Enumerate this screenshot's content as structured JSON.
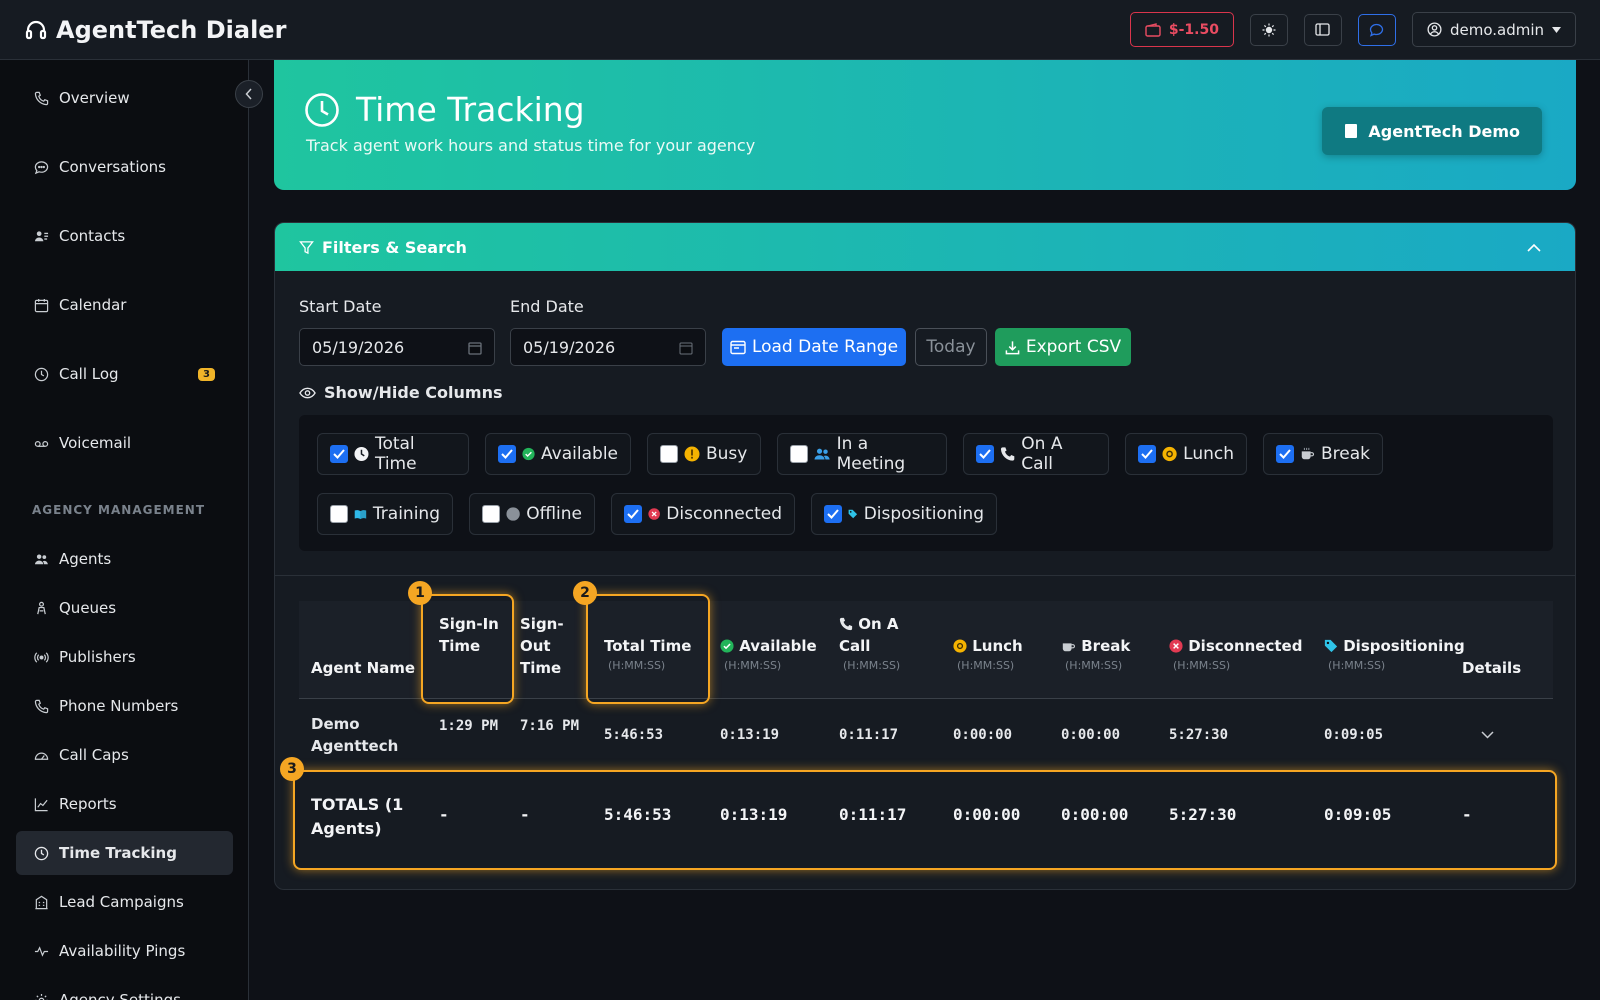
{
  "app": {
    "title": "AgentTech Dialer"
  },
  "topbar": {
    "balance": "$-1.50",
    "user": "demo.admin"
  },
  "sidebar": {
    "items": [
      {
        "label": "Overview",
        "icon": "phone-icon"
      },
      {
        "label": "Conversations",
        "icon": "chat-icon"
      },
      {
        "label": "Contacts",
        "icon": "contacts-icon"
      },
      {
        "label": "Calendar",
        "icon": "calendar-icon"
      },
      {
        "label": "Call Log",
        "icon": "clock-icon",
        "badge": "3"
      },
      {
        "label": "Voicemail",
        "icon": "voicemail-icon"
      }
    ],
    "section": "AGENCY MANAGEMENT",
    "agency_items": [
      {
        "label": "Agents",
        "icon": "users-icon"
      },
      {
        "label": "Queues",
        "icon": "queue-icon"
      },
      {
        "label": "Publishers",
        "icon": "broadcast-icon"
      },
      {
        "label": "Phone Numbers",
        "icon": "phone-icon"
      },
      {
        "label": "Call Caps",
        "icon": "gauge-icon"
      },
      {
        "label": "Reports",
        "icon": "chart-icon"
      },
      {
        "label": "Time Tracking",
        "icon": "clock-icon",
        "active": true
      },
      {
        "label": "Lead Campaigns",
        "icon": "building-icon"
      },
      {
        "label": "Availability Pings",
        "icon": "pulse-icon"
      },
      {
        "label": "Agency Settings",
        "icon": "gear-icon"
      }
    ]
  },
  "header": {
    "title": "Time Tracking",
    "subtitle": "Track agent work hours and status time for your agency",
    "agency_button": "AgentTech Demo"
  },
  "filters": {
    "title": "Filters & Search",
    "start_label": "Start Date",
    "start_value": "05/19/2026",
    "end_label": "End Date",
    "end_value": "05/19/2026",
    "load_button": "Load Date Range",
    "today_button": "Today",
    "export_button": "Export CSV",
    "columns_title": "Show/Hide Columns",
    "columns": [
      {
        "label": "Total Time",
        "checked": true,
        "icon": "clock-icon"
      },
      {
        "label": "Available",
        "checked": true,
        "icon": "check-circle-icon"
      },
      {
        "label": "Busy",
        "checked": false,
        "icon": "warning-circle-icon"
      },
      {
        "label": "In a Meeting",
        "checked": false,
        "icon": "people-icon"
      },
      {
        "label": "On A Call",
        "checked": true,
        "icon": "phone-icon"
      },
      {
        "label": "Lunch",
        "checked": true,
        "icon": "lunch-icon"
      },
      {
        "label": "Break",
        "checked": true,
        "icon": "coffee-icon"
      },
      {
        "label": "Training",
        "checked": false,
        "icon": "book-icon"
      },
      {
        "label": "Offline",
        "checked": false,
        "icon": "offline-dot-icon"
      },
      {
        "label": "Disconnected",
        "checked": true,
        "icon": "x-circle-icon"
      },
      {
        "label": "Dispositioning",
        "checked": true,
        "icon": "tag-icon"
      }
    ]
  },
  "table": {
    "headers": {
      "agent": "Agent Name",
      "signin": "Sign-In Time",
      "signout": "Sign-Out Time",
      "total": "Total Time",
      "available": "Available",
      "oncall": "On A Call",
      "lunch": "Lunch",
      "break": "Break",
      "disconnected": "Disconnected",
      "dispositioning": "Dispositioning",
      "details": "Details",
      "unit": "(H:MM:SS)"
    },
    "rows": [
      {
        "agent": "Demo Agenttech",
        "signin": "1:29 PM",
        "signout": "7:16 PM",
        "total": "5:46:53",
        "available": "0:13:19",
        "oncall": "0:11:17",
        "lunch": "0:00:00",
        "break": "0:00:00",
        "disconnected": "5:27:30",
        "dispositioning": "0:09:05"
      }
    ],
    "totals": {
      "label": "TOTALS (1 Agents)",
      "signin": "-",
      "signout": "-",
      "total": "5:46:53",
      "available": "0:13:19",
      "oncall": "0:11:17",
      "lunch": "0:00:00",
      "break": "0:00:00",
      "disconnected": "5:27:30",
      "dispositioning": "0:09:05",
      "details": "-"
    }
  },
  "highlights": [
    "1",
    "2",
    "3"
  ],
  "colors": {
    "accent": "#1fc59f",
    "highlight": "#f5a623",
    "danger": "#ea4c62",
    "primary": "#1d6ff2"
  }
}
